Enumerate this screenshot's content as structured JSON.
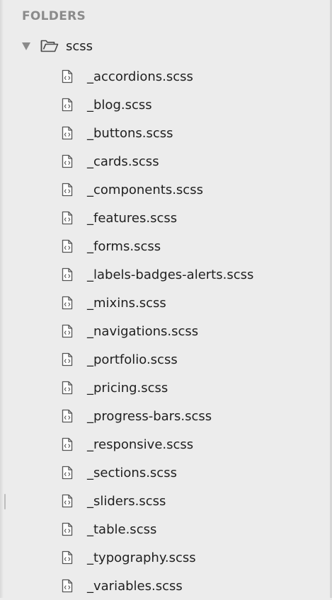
{
  "sidebar": {
    "header": "FOLDERS",
    "folder": {
      "name": "scss",
      "expanded": true,
      "disclosure_icon": "triangle-down-icon",
      "icon": "folder-open-icon"
    },
    "file_icon": "scss-file-icon",
    "files": [
      "_accordions.scss",
      "_blog.scss",
      "_buttons.scss",
      "_cards.scss",
      "_components.scss",
      "_features.scss",
      "_forms.scss",
      "_labels-badges-alerts.scss",
      "_mixins.scss",
      "_navigations.scss",
      "_portfolio.scss",
      "_pricing.scss",
      "_progress-bars.scss",
      "_responsive.scss",
      "_sections.scss",
      "_sliders.scss",
      "_table.scss",
      "_typography.scss",
      "_variables.scss"
    ]
  },
  "colors": {
    "background": "#ececec",
    "header_text": "#8b8b8b",
    "item_text": "#1f1f1f",
    "icon_stroke": "#555555",
    "disclosure": "#8a8a8a"
  }
}
